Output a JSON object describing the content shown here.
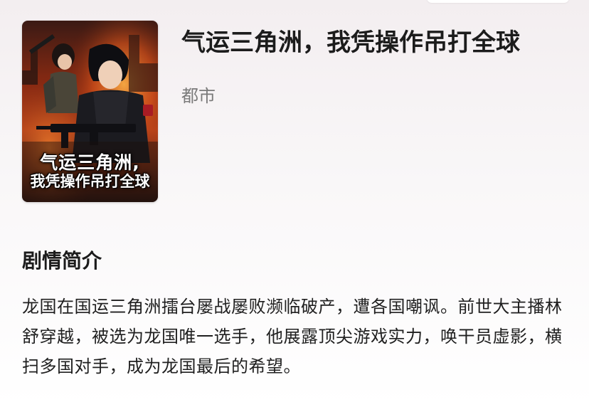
{
  "book": {
    "title": "气运三角洲，我凭操作吊打全球",
    "genre": "都市",
    "cover": {
      "title_line1": "气运三角洲,",
      "title_line2": "我凭操作吊打全球"
    }
  },
  "synopsis": {
    "heading": "剧情简介",
    "text": "龙国在国运三角洲擂台屡战屡败濒临破产，遭各国嘲讽。前世大主播林舒穿越，被选为龙国唯一选手，他展露顶尖游戏实力，唤干员虚影，横扫多国对手，成为龙国最后的希望。"
  }
}
